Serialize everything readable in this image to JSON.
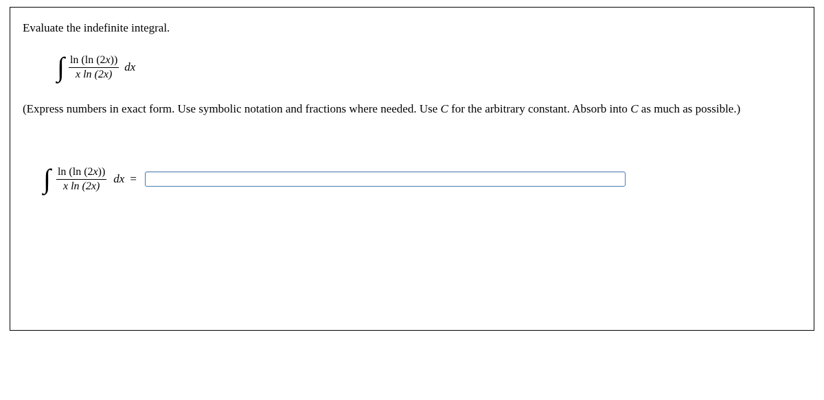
{
  "question": {
    "prompt": "Evaluate the indefinite integral.",
    "integral": {
      "numerator": "ln (ln (2x))",
      "denominator": "x ln (2x)",
      "dx": "dx"
    },
    "hint_pre": "(Express numbers in exact form. Use symbolic notation and fractions where needed. Use ",
    "hint_c1": "C",
    "hint_mid": " for the arbitrary constant. Absorb into ",
    "hint_c2": "C",
    "hint_post": " as much as possible.)",
    "answer": {
      "numerator": "ln (ln (2x))",
      "denominator": "x ln (2x)",
      "dx": "dx",
      "equals": "="
    },
    "input_value": ""
  }
}
